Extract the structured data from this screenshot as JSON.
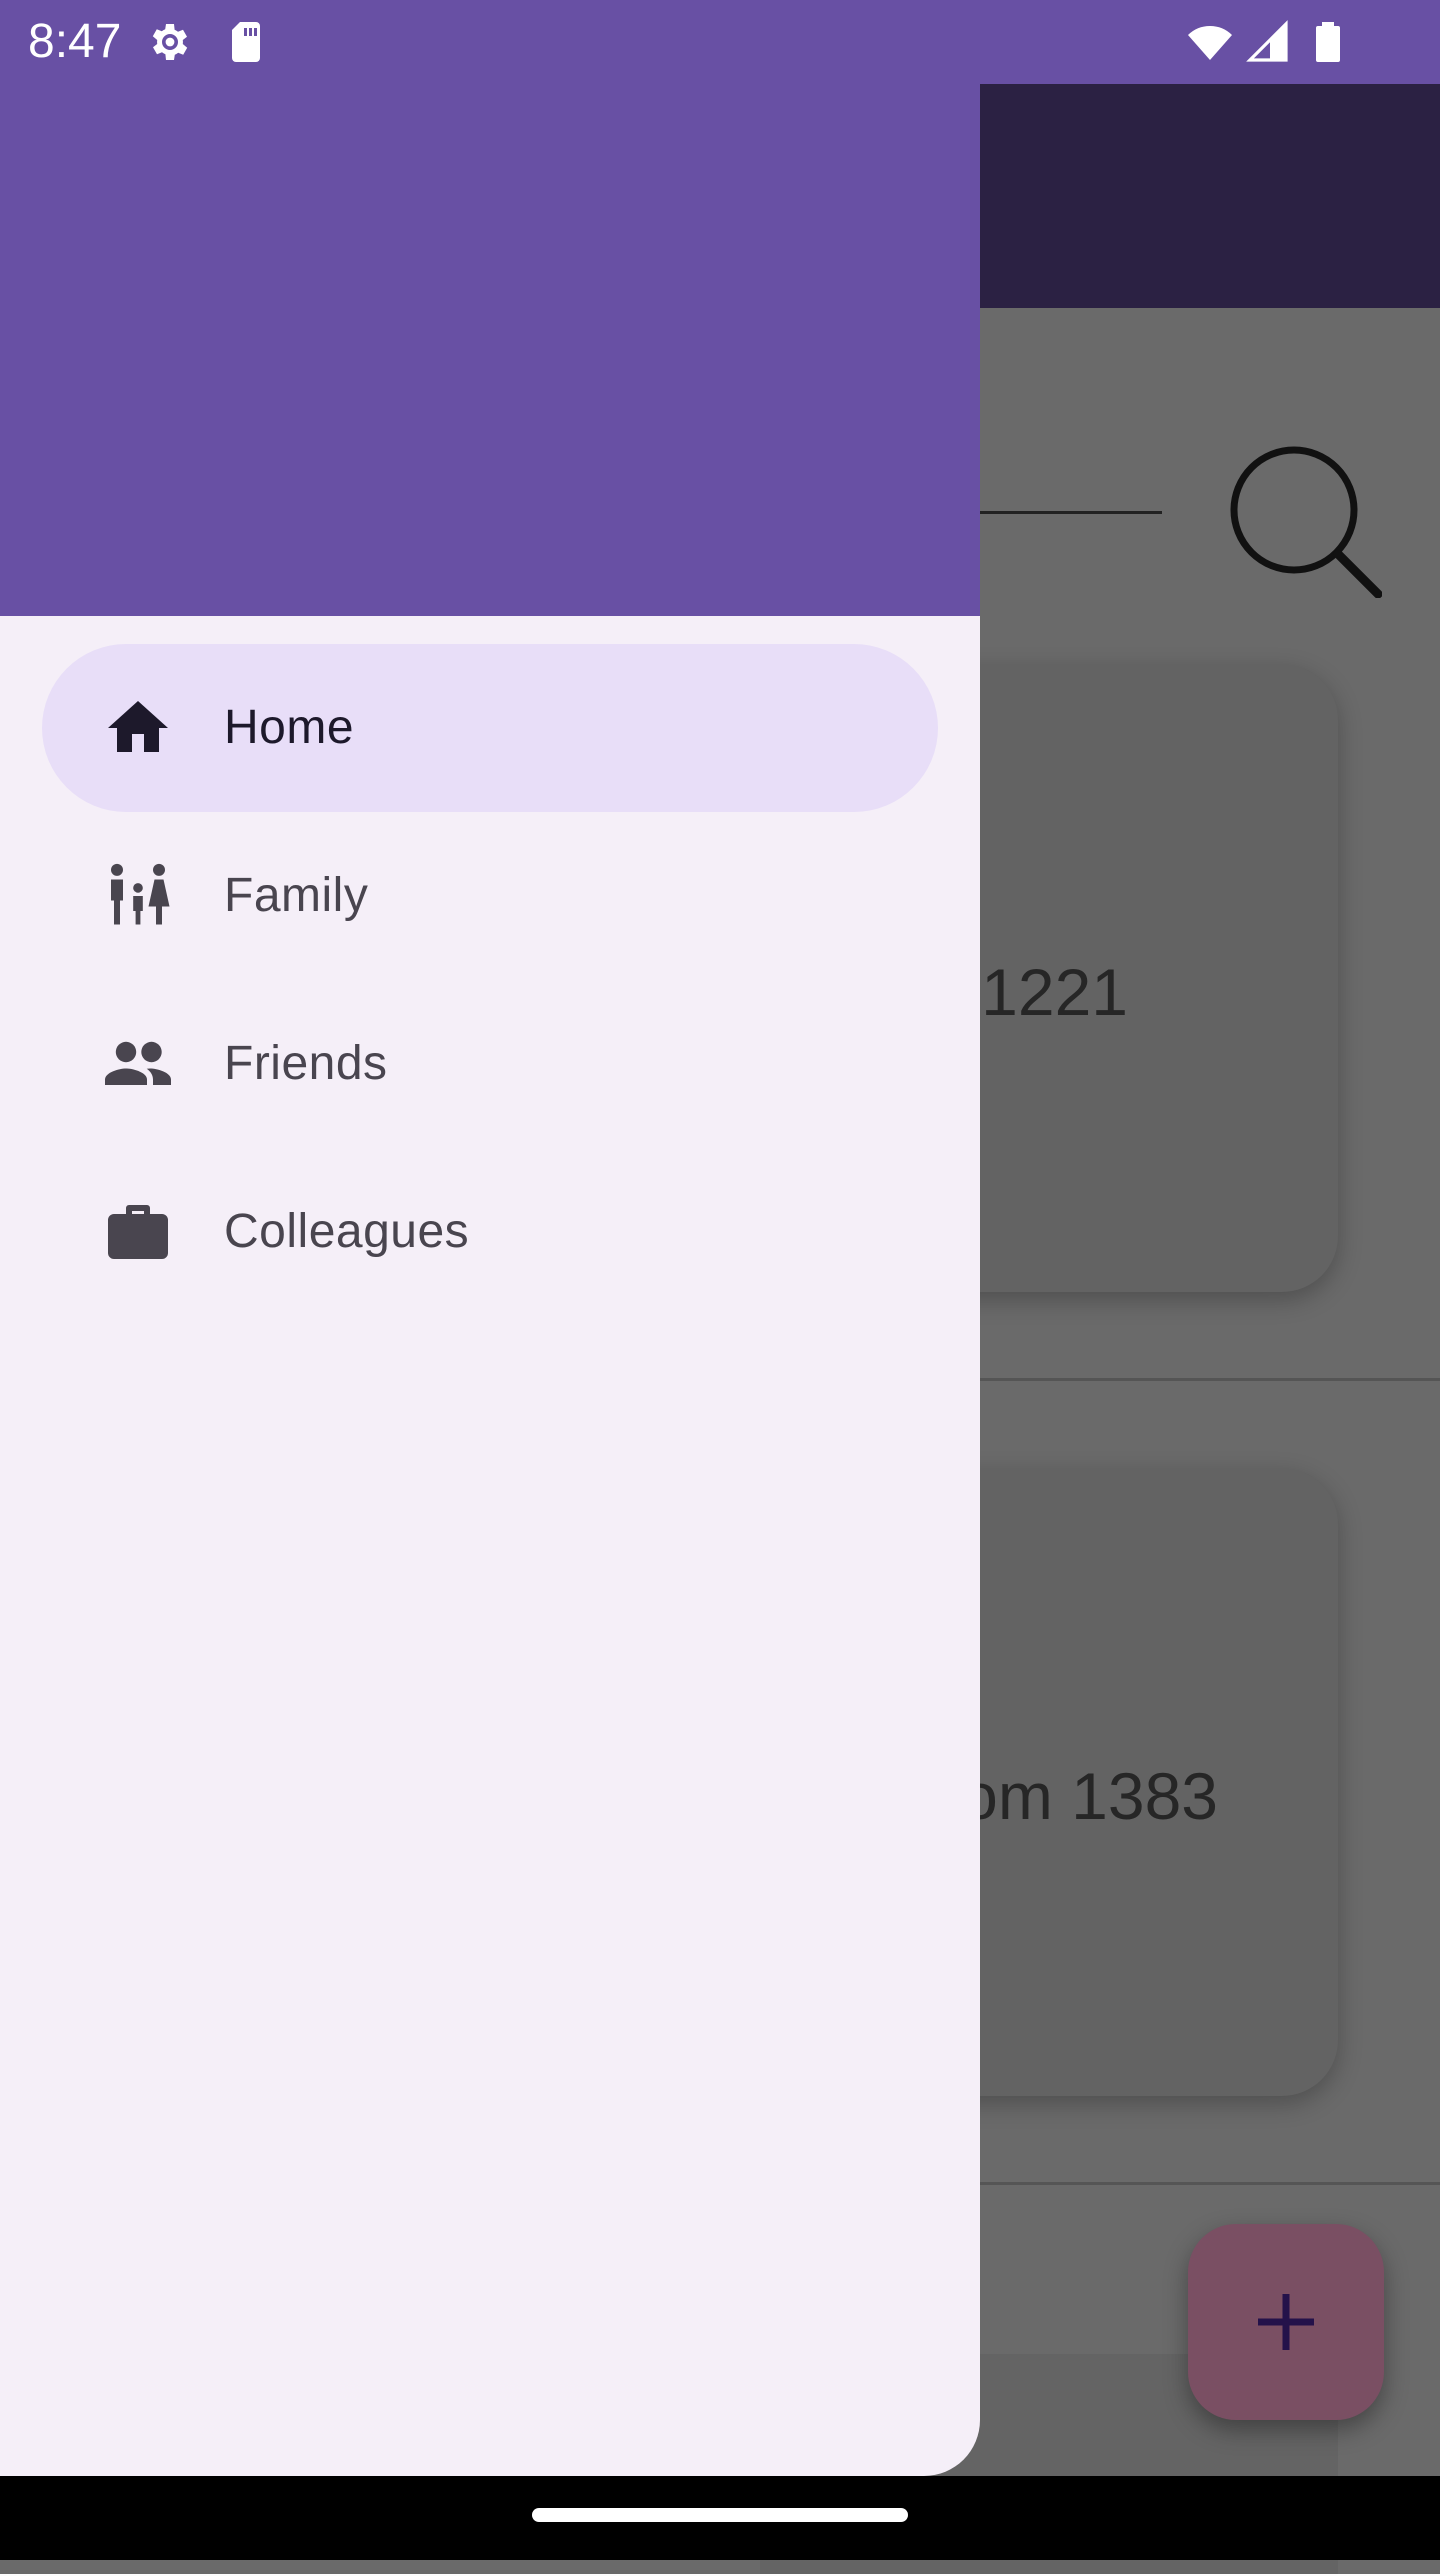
{
  "status_bar": {
    "time": "8:47",
    "icons": [
      "settings-gear-icon",
      "sd-card-icon",
      "wifi-icon",
      "cell-signal-icon",
      "battery-icon"
    ],
    "background": "#6850a4"
  },
  "drawer": {
    "header_color": "#6850a4",
    "background": "#f5eff8",
    "active_item_color": "#e8def8",
    "items": [
      {
        "label": "Home",
        "icon": "home-icon",
        "active": true
      },
      {
        "label": "Family",
        "icon": "family-icon",
        "active": false
      },
      {
        "label": "Friends",
        "icon": "friends-icon",
        "active": false
      },
      {
        "label": "Colleagues",
        "icon": "briefcase-icon",
        "active": false
      }
    ]
  },
  "background_content": {
    "cards": [
      {
        "partial_text": "1221"
      },
      {
        "partial_text": "om 1383"
      }
    ],
    "fab_icon": "add-icon",
    "fab_color": "#7a4f63"
  }
}
